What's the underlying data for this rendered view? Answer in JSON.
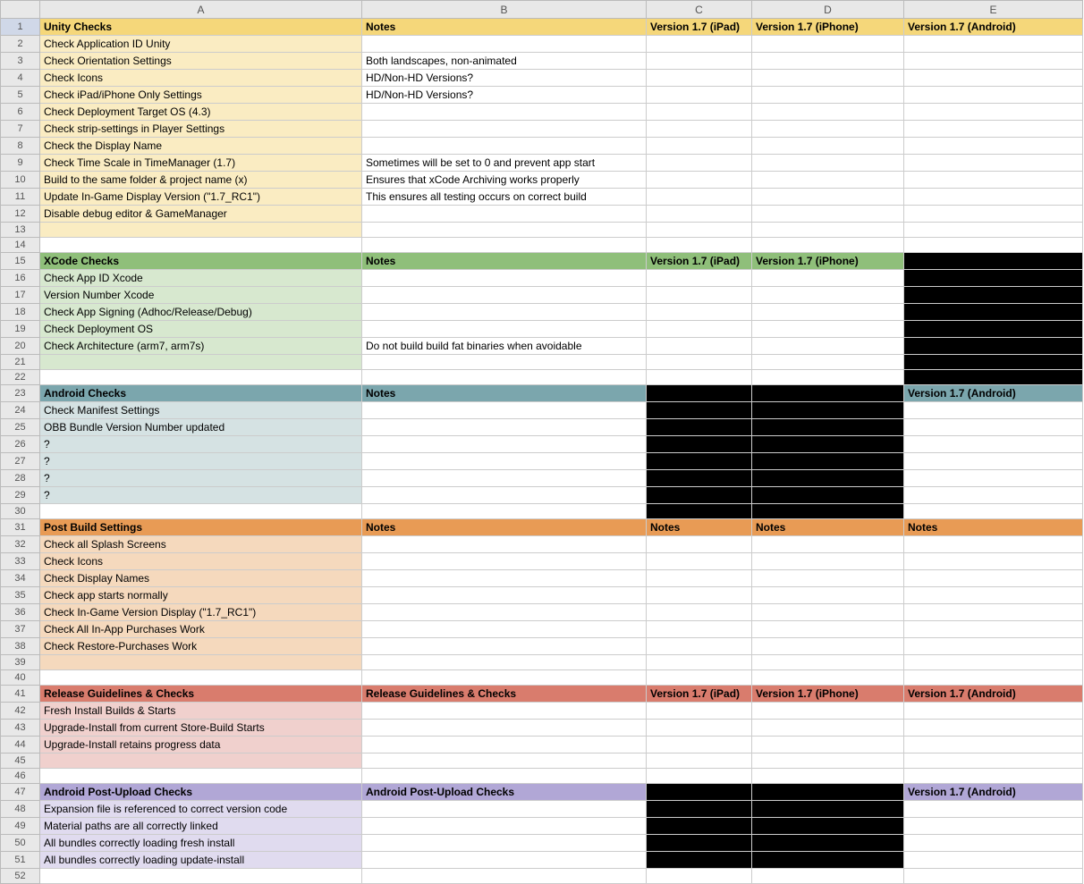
{
  "columns": [
    "A",
    "B",
    "C",
    "D",
    "E"
  ],
  "colors": {
    "yellowH": "#f5d77a",
    "yellowL": "#faecc2",
    "greenH": "#8fbf7a",
    "greenL": "#d7e8cf",
    "blueH": "#7ba6ad",
    "blueL": "#d5e2e3",
    "orangeH": "#e89b55",
    "orangeL": "#f5d9bd",
    "redH": "#d97c6d",
    "redL": "#f0d0cd",
    "purpleH": "#b1a7d6",
    "purpleL": "#e0dbef",
    "black": "#000000",
    "white": "#ffffff"
  },
  "rows": [
    {
      "n": 1,
      "hdr": true,
      "scheme": "yellow",
      "a": "Unity Checks",
      "b": "Notes",
      "c": "Version 1.7 (iPad)",
      "d": "Version 1.7 (iPhone)",
      "e": "Version 1.7 (Android)"
    },
    {
      "n": 2,
      "scheme": "yellow",
      "a": "Check Application ID Unity",
      "b": "",
      "c": "",
      "d": "",
      "e": ""
    },
    {
      "n": 3,
      "scheme": "yellow",
      "a": "Check Orientation Settings",
      "b": "Both landscapes, non-animated",
      "c": "",
      "d": "",
      "e": ""
    },
    {
      "n": 4,
      "scheme": "yellow",
      "a": "Check Icons",
      "b": "HD/Non-HD Versions?",
      "c": "",
      "d": "",
      "e": ""
    },
    {
      "n": 5,
      "scheme": "yellow",
      "a": "Check iPad/iPhone Only Settings",
      "b": "HD/Non-HD Versions?",
      "c": "",
      "d": "",
      "e": ""
    },
    {
      "n": 6,
      "scheme": "yellow",
      "a": "Check Deployment Target OS (4.3)",
      "b": "",
      "c": "",
      "d": "",
      "e": ""
    },
    {
      "n": 7,
      "scheme": "yellow",
      "a": "Check strip-settings in Player Settings",
      "b": "",
      "c": "",
      "d": "",
      "e": ""
    },
    {
      "n": 8,
      "scheme": "yellow",
      "a": "Check the Display Name",
      "b": "",
      "c": "",
      "d": "",
      "e": ""
    },
    {
      "n": 9,
      "scheme": "yellow",
      "a": "Check Time Scale in TimeManager (1.7)",
      "b": "Sometimes will be set to 0 and prevent app start",
      "c": "",
      "d": "",
      "e": ""
    },
    {
      "n": 10,
      "scheme": "yellow",
      "a": "Build to the same folder & project name (x)",
      "b": "Ensures that xCode Archiving works properly",
      "c": "",
      "d": "",
      "e": ""
    },
    {
      "n": 11,
      "scheme": "yellow",
      "a": "Update In-Game Display Version (\"1.7_RC1\")",
      "b": "This ensures all testing occurs on correct build",
      "c": "",
      "d": "",
      "e": ""
    },
    {
      "n": 12,
      "scheme": "yellow",
      "a": "Disable debug editor & GameManager",
      "b": "",
      "c": "",
      "d": "",
      "e": ""
    },
    {
      "n": 13,
      "scheme": "yellow",
      "a": "",
      "b": "",
      "c": "",
      "d": "",
      "e": ""
    },
    {
      "n": 14,
      "a": "",
      "b": "",
      "c": "",
      "d": "",
      "e": ""
    },
    {
      "n": 15,
      "hdr": true,
      "scheme": "green",
      "a": "XCode Checks",
      "b": "Notes",
      "c": "Version 1.7 (iPad)",
      "d": "Version 1.7 (iPhone)",
      "e": "",
      "eFill": "black"
    },
    {
      "n": 16,
      "scheme": "green",
      "a": "Check App ID Xcode",
      "b": "",
      "c": "",
      "d": "",
      "e": "",
      "eFill": "black"
    },
    {
      "n": 17,
      "scheme": "green",
      "a": "Version Number Xcode",
      "b": "",
      "c": "",
      "d": "",
      "e": "",
      "eFill": "black"
    },
    {
      "n": 18,
      "scheme": "green",
      "a": "Check App Signing (Adhoc/Release/Debug)",
      "b": "",
      "c": "",
      "d": "",
      "e": "",
      "eFill": "black"
    },
    {
      "n": 19,
      "scheme": "green",
      "a": "Check Deployment OS",
      "b": "",
      "c": "",
      "d": "",
      "e": "",
      "eFill": "black"
    },
    {
      "n": 20,
      "scheme": "green",
      "a": "Check Architecture (arm7, arm7s)",
      "b": "Do not build build fat binaries when avoidable",
      "c": "",
      "d": "",
      "e": "",
      "eFill": "black"
    },
    {
      "n": 21,
      "scheme": "green",
      "a": "",
      "b": "",
      "c": "",
      "d": "",
      "e": "",
      "eFill": "black"
    },
    {
      "n": 22,
      "a": "",
      "b": "",
      "c": "",
      "d": "",
      "e": "",
      "eFill": "black"
    },
    {
      "n": 23,
      "hdr": true,
      "scheme": "blue",
      "a": "Android Checks",
      "b": "Notes",
      "c": "",
      "d": "",
      "e": "Version 1.7 (Android)",
      "cFill": "black",
      "dFill": "black"
    },
    {
      "n": 24,
      "scheme": "blue",
      "a": "Check Manifest Settings",
      "b": "",
      "c": "",
      "d": "",
      "e": "",
      "cFill": "black",
      "dFill": "black"
    },
    {
      "n": 25,
      "scheme": "blue",
      "a": "OBB Bundle Version Number updated",
      "b": "",
      "c": "",
      "d": "",
      "e": "",
      "cFill": "black",
      "dFill": "black"
    },
    {
      "n": 26,
      "scheme": "blue",
      "a": "?",
      "b": "",
      "c": "",
      "d": "",
      "e": "",
      "cFill": "black",
      "dFill": "black"
    },
    {
      "n": 27,
      "scheme": "blue",
      "a": "?",
      "b": "",
      "c": "",
      "d": "",
      "e": "",
      "cFill": "black",
      "dFill": "black"
    },
    {
      "n": 28,
      "scheme": "blue",
      "a": "?",
      "b": "",
      "c": "",
      "d": "",
      "e": "",
      "cFill": "black",
      "dFill": "black"
    },
    {
      "n": 29,
      "scheme": "blue",
      "a": "?",
      "b": "",
      "c": "",
      "d": "",
      "e": "",
      "cFill": "black",
      "dFill": "black"
    },
    {
      "n": 30,
      "a": "",
      "b": "",
      "c": "",
      "d": "",
      "e": "",
      "cFill": "black",
      "dFill": "black"
    },
    {
      "n": 31,
      "hdr": true,
      "scheme": "orange",
      "a": "Post Build Settings",
      "b": "Notes",
      "c": "Notes",
      "d": "Notes",
      "e": "Notes"
    },
    {
      "n": 32,
      "scheme": "orange",
      "a": "Check all Splash Screens",
      "b": "",
      "c": "",
      "d": "",
      "e": ""
    },
    {
      "n": 33,
      "scheme": "orange",
      "a": "Check Icons",
      "b": "",
      "c": "",
      "d": "",
      "e": ""
    },
    {
      "n": 34,
      "scheme": "orange",
      "a": "Check Display Names",
      "b": "",
      "c": "",
      "d": "",
      "e": ""
    },
    {
      "n": 35,
      "scheme": "orange",
      "a": "Check app starts normally",
      "b": "",
      "c": "",
      "d": "",
      "e": ""
    },
    {
      "n": 36,
      "scheme": "orange",
      "a": "Check In-Game Version Display (\"1.7_RC1\")",
      "b": "",
      "c": "",
      "d": "",
      "e": ""
    },
    {
      "n": 37,
      "scheme": "orange",
      "a": "Check All In-App Purchases Work",
      "b": "",
      "c": "",
      "d": "",
      "e": ""
    },
    {
      "n": 38,
      "scheme": "orange",
      "a": "Check Restore-Purchases Work",
      "b": "",
      "c": "",
      "d": "",
      "e": ""
    },
    {
      "n": 39,
      "scheme": "orange",
      "a": "",
      "b": "",
      "c": "",
      "d": "",
      "e": ""
    },
    {
      "n": 40,
      "a": "",
      "b": "",
      "c": "",
      "d": "",
      "e": ""
    },
    {
      "n": 41,
      "hdr": true,
      "scheme": "red",
      "a": "Release Guidelines & Checks",
      "b": "Release Guidelines & Checks",
      "c": "Version 1.7 (iPad)",
      "d": "Version 1.7 (iPhone)",
      "e": "Version 1.7 (Android)"
    },
    {
      "n": 42,
      "scheme": "red",
      "a": "Fresh Install Builds & Starts",
      "b": "",
      "c": "",
      "d": "",
      "e": ""
    },
    {
      "n": 43,
      "scheme": "red",
      "a": "Upgrade-Install from current Store-Build Starts",
      "b": "",
      "c": "",
      "d": "",
      "e": ""
    },
    {
      "n": 44,
      "scheme": "red",
      "a": "Upgrade-Install retains progress data",
      "b": "",
      "c": "",
      "d": "",
      "e": ""
    },
    {
      "n": 45,
      "scheme": "red",
      "a": "",
      "b": "",
      "c": "",
      "d": "",
      "e": ""
    },
    {
      "n": 46,
      "a": "",
      "b": "",
      "c": "",
      "d": "",
      "e": ""
    },
    {
      "n": 47,
      "hdr": true,
      "scheme": "purple",
      "a": "Android Post-Upload Checks",
      "b": "Android Post-Upload Checks",
      "c": "",
      "d": "",
      "e": "Version 1.7 (Android)",
      "cFill": "black",
      "dFill": "black"
    },
    {
      "n": 48,
      "scheme": "purple",
      "a": "Expansion file is referenced to correct version code",
      "b": "",
      "c": "",
      "d": "",
      "e": "",
      "cFill": "black",
      "dFill": "black"
    },
    {
      "n": 49,
      "scheme": "purple",
      "a": "Material paths are all correctly linked",
      "b": "",
      "c": "",
      "d": "",
      "e": "",
      "cFill": "black",
      "dFill": "black"
    },
    {
      "n": 50,
      "scheme": "purple",
      "a": "All bundles correctly loading fresh install",
      "b": "",
      "c": "",
      "d": "",
      "e": "",
      "cFill": "black",
      "dFill": "black"
    },
    {
      "n": 51,
      "scheme": "purple",
      "a": "All bundles correctly loading update-install",
      "b": "",
      "c": "",
      "d": "",
      "e": "",
      "cFill": "black",
      "dFill": "black"
    },
    {
      "n": 52,
      "a": "",
      "b": "",
      "c": "",
      "d": "",
      "e": ""
    }
  ]
}
